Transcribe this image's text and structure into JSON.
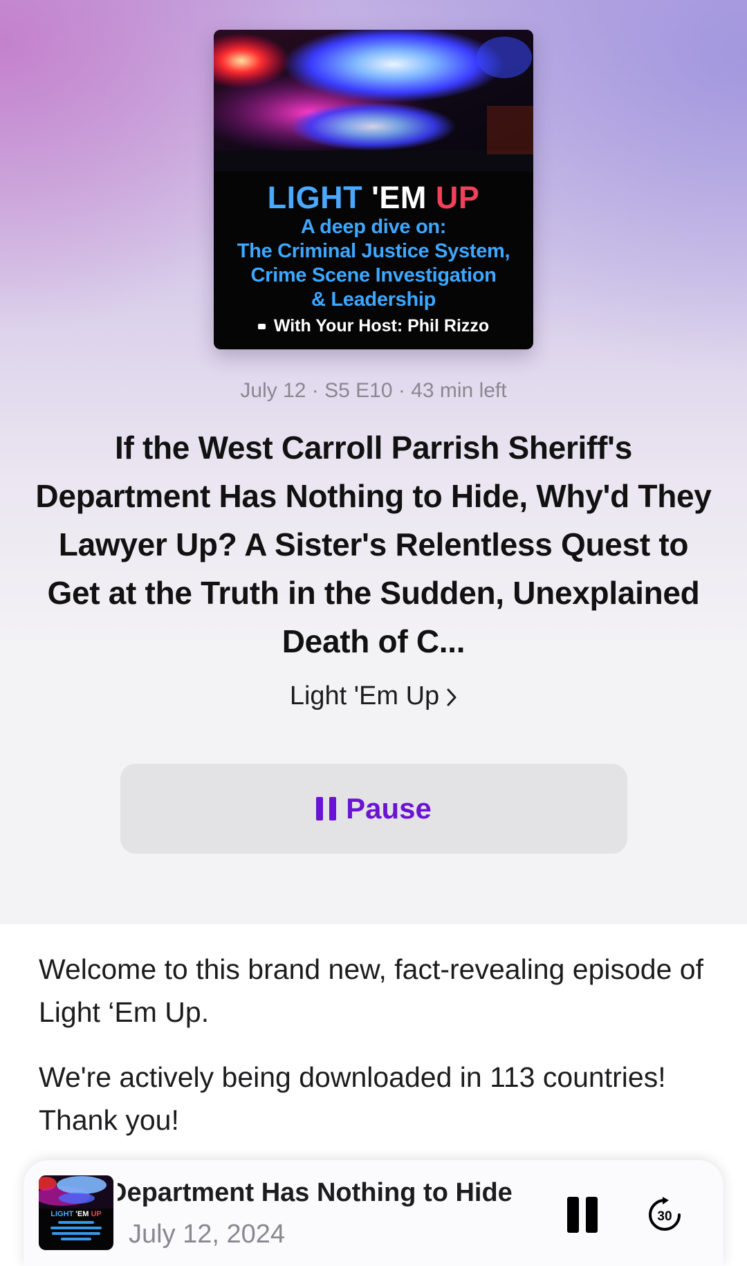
{
  "artwork": {
    "title_part1": "LIGHT",
    "title_part2": "'EM",
    "title_part3": "UP",
    "line1": "A deep dive on:",
    "line2": "The Criminal Justice System,",
    "line3": "Crime Scene Investigation",
    "line4": "& Leadership",
    "host": "With Your Host: Phil Rizzo"
  },
  "episode": {
    "meta": "July 12 · S5 E10 · 43 min left",
    "title": "If the West Carroll Parrish Sheriff's Department Has Nothing to Hide, Why'd They Lawyer Up? A Sister's Relentless Quest to Get at the Truth in the Sudden, Unexplained Death of C...",
    "show_name": "Light 'Em Up",
    "pause_label": "Pause"
  },
  "description": {
    "paragraph1": "Welcome to this brand new, fact-revealing episode of Light ‘Em Up.",
    "paragraph2": "We're actively being downloaded in 113 countries! Thank you!"
  },
  "mini_player": {
    "title": "Department Has Nothing to Hide",
    "date": "July 12, 2024",
    "skip_seconds": "30",
    "art_title_a": "LIGHT",
    "art_title_b": "'EM",
    "art_title_c": "UP"
  },
  "colors": {
    "accent": "#6a13d3",
    "artwork_blue": "#3ea7ff",
    "artwork_red": "#f0405a"
  }
}
